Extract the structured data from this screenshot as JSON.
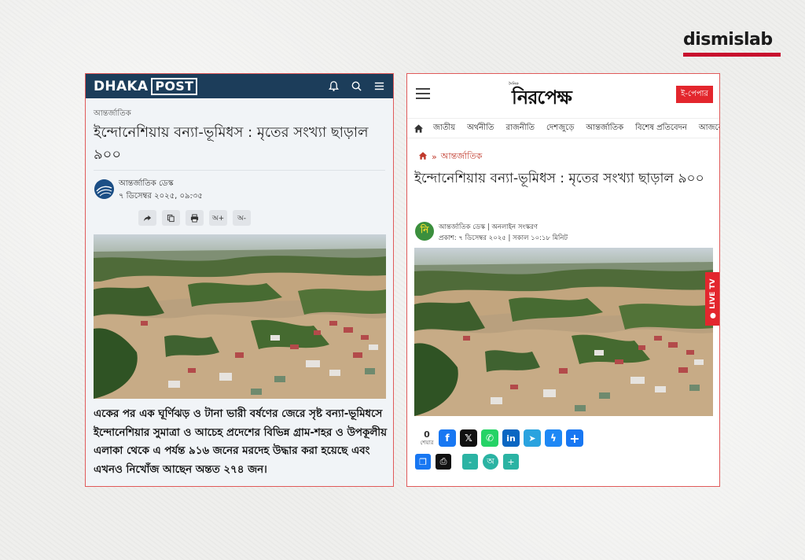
{
  "brand": {
    "name": "dismislab",
    "accent": "#c8102e"
  },
  "left_site": {
    "logo_text_1": "DHAKA",
    "logo_text_2": "POST",
    "header_color": "#1c3d5a",
    "icons": [
      "bell-icon",
      "search-icon",
      "menu-icon"
    ],
    "category": "আন্তর্জাতিক",
    "title": "ইন্দোনেশিয়ায় বন্যা-ভূমিধস : মৃতের সংখ্যা ছাড়াল ৯০০",
    "author": "আন্তর্জাতিক ডেস্ক",
    "date": "৭ ডিসেম্বর ২০২৫, ০৯:৩৫",
    "tools": [
      {
        "icon": "share-icon",
        "label": ""
      },
      {
        "icon": "copy-icon",
        "label": ""
      },
      {
        "icon": "print-icon",
        "label": ""
      },
      {
        "icon": "font-increase-icon",
        "label": "অ+"
      },
      {
        "icon": "font-decrease-icon",
        "label": "অ-"
      }
    ],
    "body": "একের পর এক ঘূর্ণিঝড় ও টানা ভারী বর্ষণের জেরে সৃষ্ট বন্যা-ভূমিধসে ইন্দোনেশিয়ার সুমাত্রা ও আচেহ প্রদেশের বিভিন্ন গ্রাম-শহর ও উপকূলীয় এলাকা থেকে এ পর্যন্ত ৯১৬ জনের মরদেহ উদ্ধার করা হয়েছে এবং এখনও নিখোঁজ আছেন অন্তত ২৭৪ জন।"
  },
  "right_site": {
    "logo_text": "নিরপেক্ষ",
    "logo_small": "দৈনিক",
    "epaper_label": "ই-পেপার",
    "nav": [
      "জাতীয়",
      "অর্থনীতি",
      "রাজনীতি",
      "দেশজুড়ে",
      "আন্তর্জাতিক",
      "বিশেষ প্রতিবেদন",
      "আজকে"
    ],
    "breadcrumb_sep": "»",
    "category": "আন্তর্জাতিক",
    "title": "ইন্দোনেশিয়ায় বন্যা-ভূমিধস : মৃতের সংখ্যা ছাড়াল ৯০০",
    "avatar_letter": "নি",
    "author": "আন্তর্জাতিক ডেস্ক | অনলাইন সংস্করণ",
    "date": "প্রকাশ: ৭ ডিসেম্বর ২০২৫ | সকাল ১০:১৮ মিনিট",
    "live_label": "● LIVE TV",
    "share_count": "0",
    "share_label": "শেয়ার",
    "share_buttons": [
      {
        "icon": "facebook-icon",
        "glyph": "f",
        "color": "#1877f2"
      },
      {
        "icon": "x-icon",
        "glyph": "𝕏",
        "color": "#111111"
      },
      {
        "icon": "whatsapp-icon",
        "glyph": "✆",
        "color": "#25d366"
      },
      {
        "icon": "linkedin-icon",
        "glyph": "in",
        "color": "#0a66c2"
      },
      {
        "icon": "telegram-icon",
        "glyph": "➤",
        "color": "#2aa3df"
      },
      {
        "icon": "messenger-icon",
        "glyph": "ϟ",
        "color": "#1e88f5"
      },
      {
        "icon": "more-share-icon",
        "glyph": "+",
        "color": "#1877f2"
      }
    ],
    "tools": [
      {
        "icon": "copy-icon",
        "glyph": "❐",
        "color": "#1877f2"
      },
      {
        "icon": "print-icon",
        "glyph": "⎙",
        "color": "#111111"
      },
      {
        "icon": "font-decrease-icon",
        "glyph": "-",
        "color": "#2bb3a3"
      },
      {
        "icon": "font-reset-icon",
        "glyph": "অ",
        "color": "#2bb3a3"
      },
      {
        "icon": "font-increase-icon",
        "glyph": "+",
        "color": "#2bb3a3"
      }
    ]
  }
}
